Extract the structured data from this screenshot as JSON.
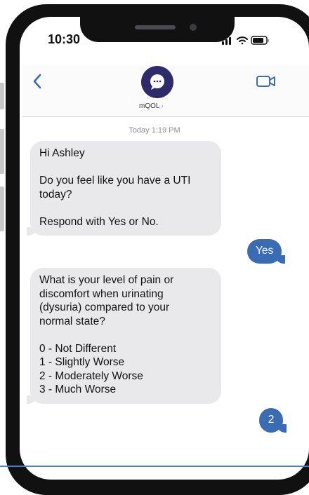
{
  "status": {
    "time": "10:30"
  },
  "header": {
    "contact_name": "mQOL",
    "back_icon": "chevron-left-icon",
    "video_icon": "video-camera-icon",
    "avatar_icon": "chat-bubble-icon"
  },
  "conversation": {
    "timestamp": "Today 1:19 PM",
    "messages": [
      {
        "direction": "incoming",
        "lines": [
          "Hi Ashley",
          "",
          "Do you feel like you have a UTI",
          "today?",
          "",
          "Respond with Yes or No."
        ]
      },
      {
        "direction": "outgoing",
        "lines": [
          "Yes"
        ]
      },
      {
        "direction": "incoming",
        "lines": [
          "What is your level of pain or",
          "discomfort when urinating",
          "(dysuria) compared to your",
          "normal state?",
          "",
          "0 - Not Different",
          "1 - Slightly Worse",
          "2 - Moderately Worse",
          "3 - Much Worse"
        ]
      },
      {
        "direction": "outgoing",
        "lines": [
          "2"
        ]
      }
    ]
  },
  "colors": {
    "accent": "#3a6cb4",
    "incoming_bubble": "#e9e9eb",
    "avatar": "#2e2b6b",
    "timestamp": "#8e8e93"
  }
}
